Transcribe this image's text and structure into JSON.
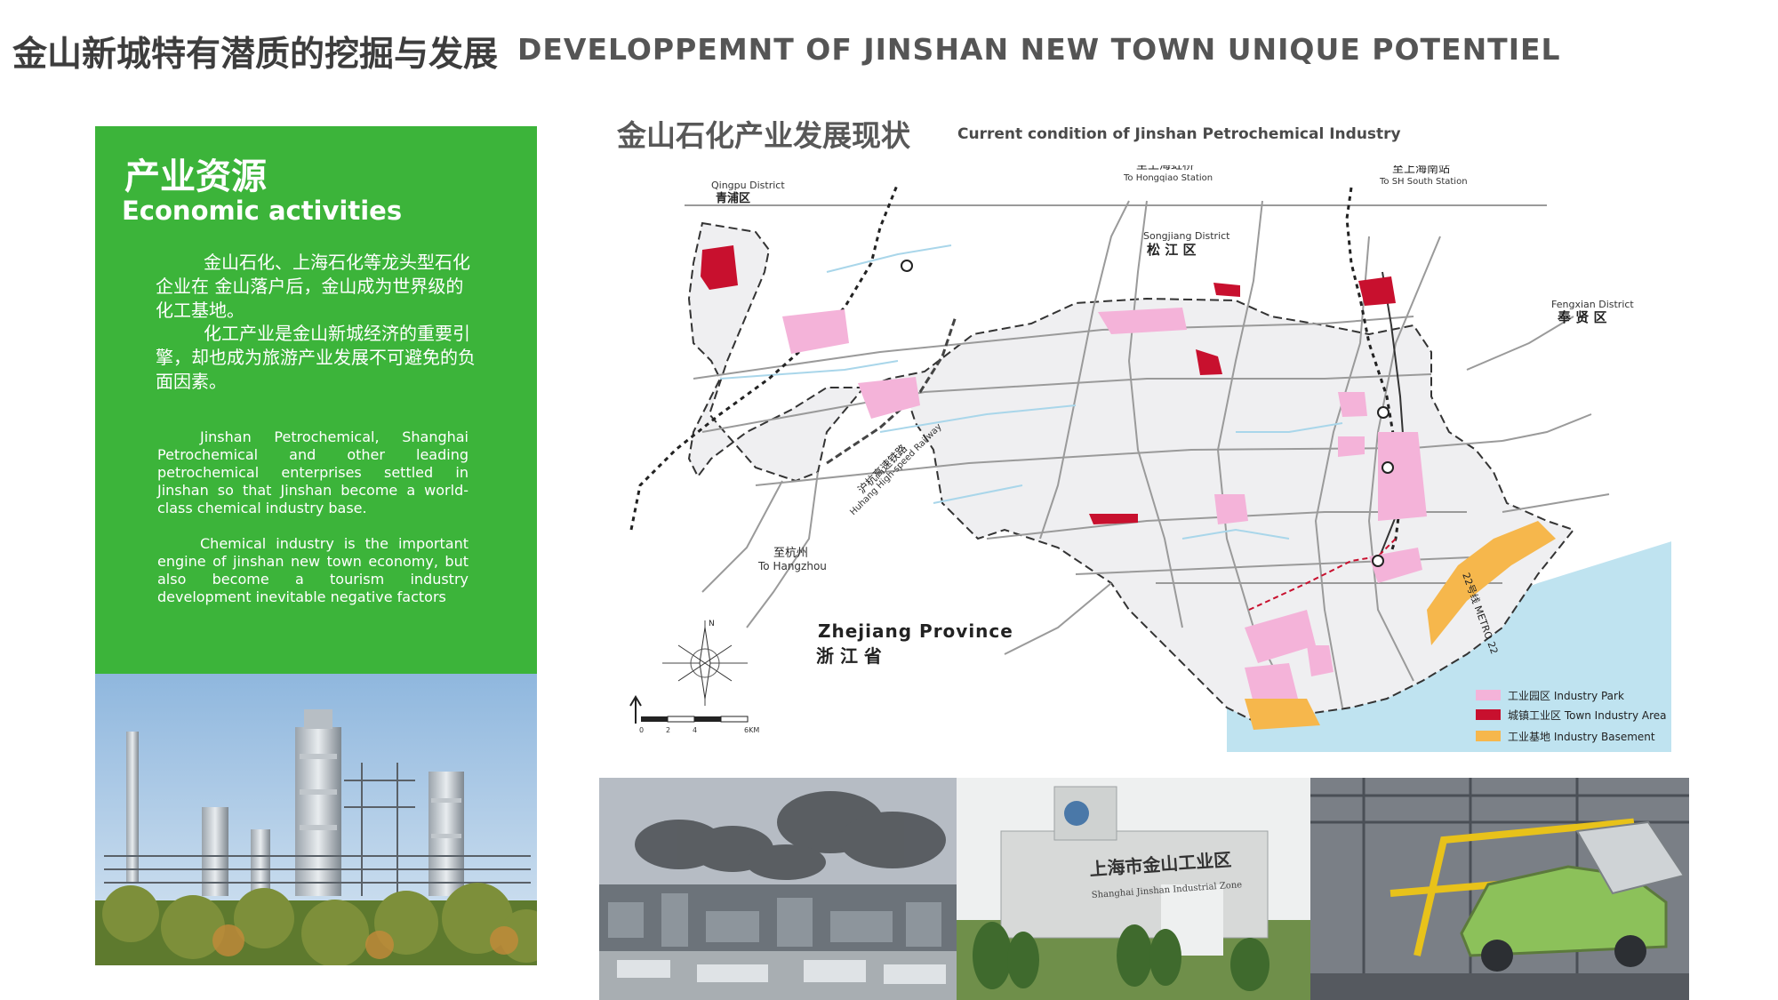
{
  "header": {
    "title_cn": "金山新城特有潜质的挖掘与发展",
    "title_en": "DEVELOPPEMNT OF JINSHAN NEW TOWN UNIQUE POTENTIEL"
  },
  "panel": {
    "title_cn": "产业资源",
    "title_en": "Economic activities",
    "para_cn_1": "金山石化、上海石化等龙头型石化企业在 金山落户后，金山成为世界级的化工基地。",
    "para_cn_2": "化工产业是金山新城经济的重要引擎，却也成为旅游产业发展不可避免的负面因素。",
    "para_en_1": "Jinshan Petrochemical, Shanghai Petrochemical and other leading petrochemical enterprises settled in Jinshan so that Jinshan become a world-class chemical industry base.",
    "para_en_2": "Chemical industry is the important engine of jinshan new town economy, but also become a tourism industry development inevitable negative factors"
  },
  "map": {
    "title_cn": "金山石化产业发展现状",
    "title_en": "Current condition of Jinshan Petrochemical Industry",
    "districts": {
      "qingpu_en": "Qingpu District",
      "qingpu_cn": "青浦区",
      "songjiang_en": "Songjiang District",
      "songjiang_cn": "松 江 区",
      "fengxian_en": "Fengxian District",
      "fengxian_cn": "奉 贤 区"
    },
    "labels": {
      "hongqiao_cn": "至上海虹桥",
      "hongqiao_en": "To Hongqiao Station",
      "south_cn": "至上海南站",
      "south_en": "To SH South Station",
      "hangzhou_cn": "至杭州",
      "hangzhou_en": "To Hangzhou",
      "railway_cn": "沪杭高速铁路",
      "railway_en": "Huhang High-speed Railway",
      "metro": "22号线 METRO 22",
      "province_en": "Zhejiang  Province",
      "province_cn": "浙    江    省",
      "compass_n": "N",
      "scale_0": "0",
      "scale_2": "2",
      "scale_4": "4",
      "scale_unit": "6KM"
    },
    "legend": [
      {
        "label": "工业园区 Industry Park",
        "color": "#f4b3d9"
      },
      {
        "label": "城镇工业区 Town Industry Area",
        "color": "#c8102e"
      },
      {
        "label": "工业基地 Industry Basement",
        "color": "#f6b74c"
      }
    ],
    "colors": {
      "land": "#efeff1",
      "sea": "#bfe3f0",
      "park": "#f4b3d9",
      "town": "#c8102e",
      "basement": "#f6b74c"
    }
  },
  "photos": {
    "gate_sign_cn": "上海市金山工业区",
    "gate_sign_en": "Shanghai Jinshan Industrial Zone"
  }
}
